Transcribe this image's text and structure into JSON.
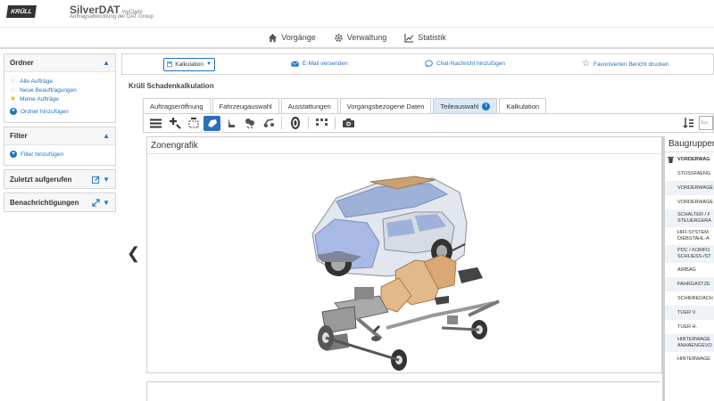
{
  "header": {
    "logo": "KRÜLL",
    "app_name": "SilverDAT",
    "app_suffix": "myClaim",
    "subtitle": "Auftragsabwicklung der DAT Group"
  },
  "nav": {
    "items": [
      {
        "label": "Vorgänge",
        "icon": "home-icon"
      },
      {
        "label": "Verwaltung",
        "icon": "gear-icon"
      },
      {
        "label": "Statistik",
        "icon": "chart-icon"
      }
    ]
  },
  "sidebar": {
    "ordner": {
      "title": "Ordner",
      "items": [
        "Alle Aufträge",
        "Neue Beauftragungen",
        "Meine Aufträge"
      ],
      "add_label": "Ordner hinzufügen"
    },
    "filter": {
      "title": "Filter",
      "add_label": "Filter hinzufügen"
    },
    "recent": {
      "title": "Zuletzt aufgerufen"
    },
    "notifications": {
      "title": "Benachrichtigungen"
    }
  },
  "toolbar": {
    "dropdown_value": "Kalkulation",
    "email_label": "E-Mail versenden",
    "chat_label": "Chat-Nachricht hinzufügen",
    "report_label": "Favorisierten Bericht drucken"
  },
  "calc_title": "Krüll Schadenkalkulation",
  "tabs": [
    {
      "label": "Auftragseröffnung",
      "active": false
    },
    {
      "label": "Fahrzeugauswahl",
      "active": false
    },
    {
      "label": "Ausstattungen",
      "active": false
    },
    {
      "label": "Vorgangsbezogene Daten",
      "active": false
    },
    {
      "label": "Teileauswahl",
      "active": true,
      "badge": "i"
    },
    {
      "label": "Kalkulation",
      "active": false
    }
  ],
  "search_placeholder": "Suc",
  "zone": {
    "title": "Zonengrafik"
  },
  "parts": {
    "title": "Baugruppen",
    "items": [
      "VORDERWAG",
      "STOSSFAENG",
      "VORDERWAGE",
      "VORDERWAGE",
      "SCHALTER / F\nSTEUERGERA",
      "HIFI-SYSTEM\nDIEBSTAHL-A",
      "PDC / KOMFO\nSCHLIESS-/ST",
      "AIRBAG",
      "FAHRGASTZE",
      "SCHIEBEDACH",
      "TUER V.",
      "TUER H.",
      "HINTERWAGE\nANHAENGEVO",
      "HINTERWAGE"
    ]
  }
}
